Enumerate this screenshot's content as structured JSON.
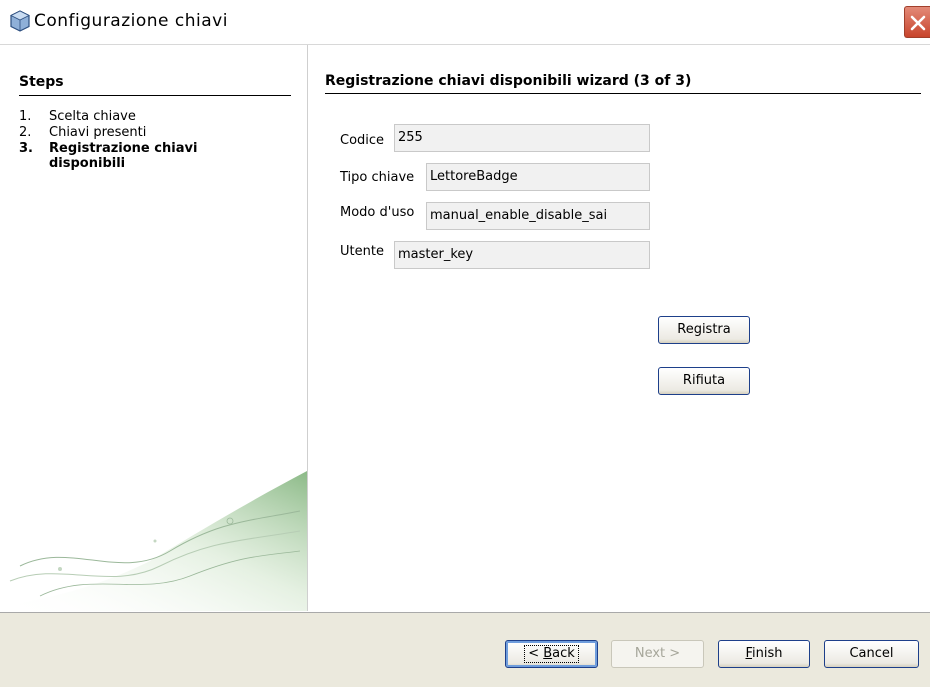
{
  "window": {
    "title": "Configurazione chiavi",
    "icon": "cube-icon",
    "close_icon": "close-icon"
  },
  "steps": {
    "title": "Steps",
    "items": [
      {
        "num": "1.",
        "label": "Scelta chiave"
      },
      {
        "num": "2.",
        "label": "Chiavi presenti"
      },
      {
        "num": "3.",
        "label": "Registrazione chiavi disponibili"
      }
    ]
  },
  "content": {
    "title": "Registrazione chiavi disponibili wizard (3 of 3)",
    "fields": {
      "codice": {
        "label": "Codice",
        "value": "255"
      },
      "tipo": {
        "label": "Tipo chiave",
        "value": "LettoreBadge"
      },
      "modo": {
        "label": "Modo d'uso",
        "value": "manual_enable_disable_sai"
      },
      "utente": {
        "label": "Utente",
        "value": "master_key"
      }
    },
    "registra_label": "Registra",
    "rifiuta_label": "Rifiuta"
  },
  "footer": {
    "back_pre": "< ",
    "back_u": "B",
    "back_post": "ack",
    "next_label": "Next >",
    "finish_u": "F",
    "finish_post": "inish",
    "cancel_label": "Cancel"
  },
  "colors": {
    "footer_bg": "#ebe9dd",
    "button_border": "#1d3f8a",
    "close_red": "#c8442c"
  }
}
